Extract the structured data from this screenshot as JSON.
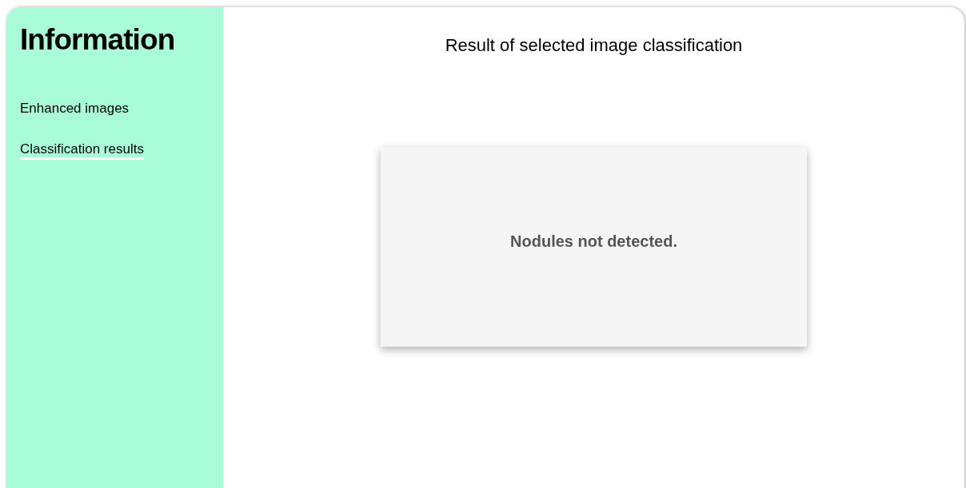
{
  "sidebar": {
    "title": "Information",
    "items": [
      {
        "label": "Enhanced images",
        "selected": false
      },
      {
        "label": "Classification results",
        "selected": true
      }
    ]
  },
  "main": {
    "heading": "Result of selected image classification",
    "result": "Nodules not detected."
  }
}
